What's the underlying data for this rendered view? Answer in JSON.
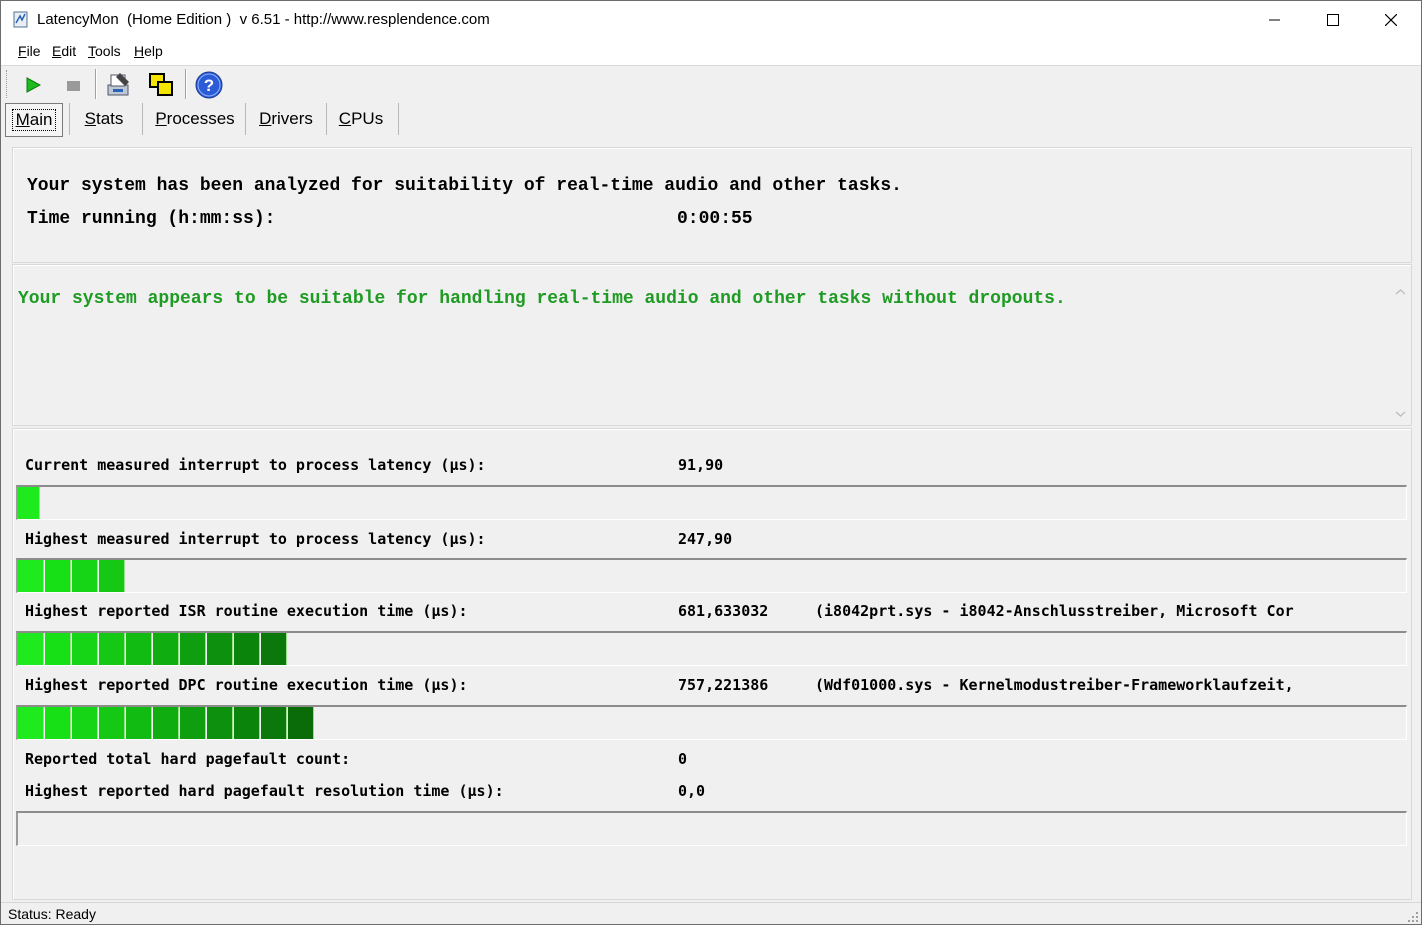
{
  "window": {
    "title": "LatencyMon  (Home Edition )  v 6.51 - http://www.resplendence.com"
  },
  "menu": [
    "File",
    "Edit",
    "Tools",
    "Help"
  ],
  "toolbar": {
    "buttons": [
      "start-icon",
      "stop-icon",
      "report-icon",
      "copy-icon",
      "help-icon"
    ]
  },
  "tabs": [
    "Main",
    "Stats",
    "Processes",
    "Drivers",
    "CPUs"
  ],
  "summary": {
    "analyzed_text": "Your system has been analyzed for suitability of real-time audio and other tasks.",
    "time_label": "Time running (h:mm:ss):",
    "time_value": "0:00:55"
  },
  "verdict": {
    "text": "Your system appears to be suitable for handling real-time audio and other tasks without dropouts.",
    "color": "#1e9b22"
  },
  "metrics": [
    {
      "label": "Current measured interrupt to process latency (µs):",
      "value": "91,90",
      "detail": "",
      "bar_segments": 1
    },
    {
      "label": "Highest measured interrupt to process latency (µs):",
      "value": "247,90",
      "detail": "",
      "bar_segments": 4
    },
    {
      "label": "Highest reported ISR routine execution time (µs):",
      "value": "681,633032",
      "detail": "(i8042prt.sys - i8042-Anschlusstreiber, Microsoft Cor",
      "bar_segments": 10
    },
    {
      "label": "Highest reported DPC routine execution time (µs):",
      "value": "757,221386",
      "detail": "(Wdf01000.sys - Kernelmodustreiber-Frameworklaufzeit,",
      "bar_segments": 11
    },
    {
      "label": "Reported total hard pagefault count:",
      "value": "0",
      "detail": ""
    },
    {
      "label": "Highest reported hard pagefault resolution time (µs):",
      "value": "0,0",
      "detail": "",
      "bar_segments": 0
    }
  ],
  "status": {
    "text": "Status: Ready"
  }
}
